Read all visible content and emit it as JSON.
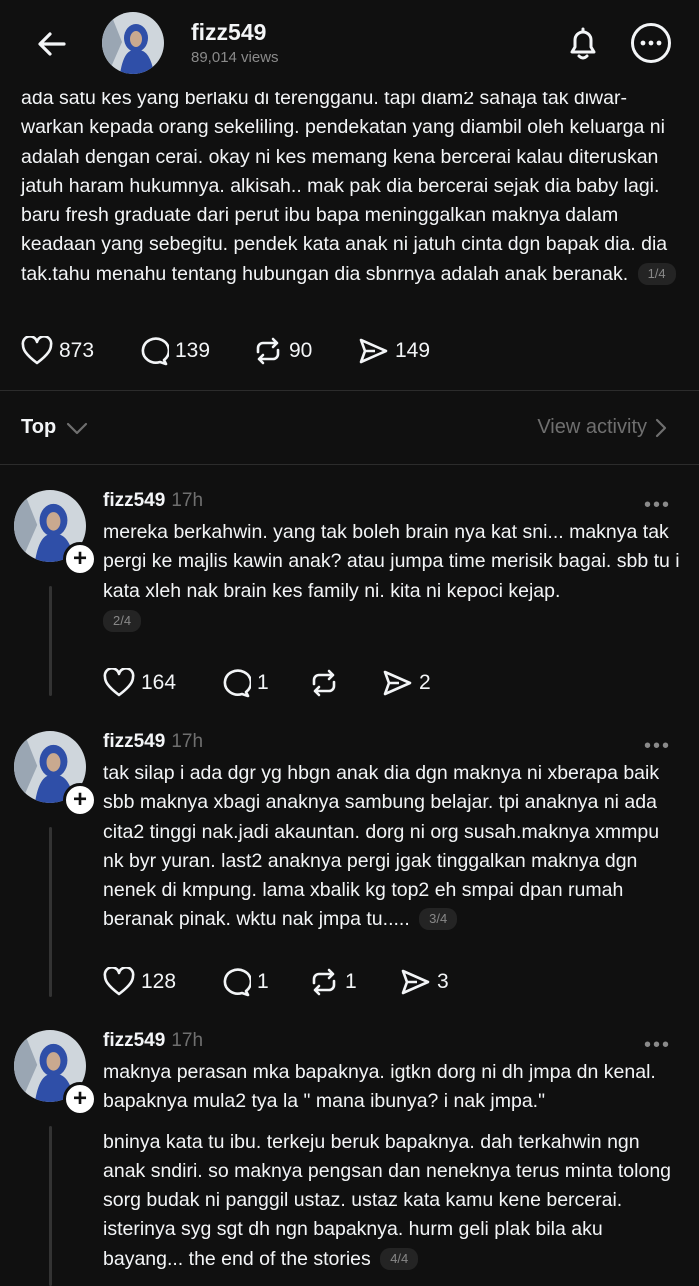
{
  "header": {
    "username": "fizz549",
    "views": "89,014 views",
    "icons": [
      "back-arrow-icon",
      "bell-icon",
      "more-options-icon"
    ]
  },
  "post": {
    "text": "ada satu kes yang berlaku di terengganu. tapi diam2 sahaja tak diwar-warkan kepada orang sekeliling. pendekatan yang diambil oleh keluarga ni adalah dengan cerai. okay ni kes memang kena bercerai kalau diteruskan jatuh haram hukumnya. alkisah.. mak pak dia bercerai sejak dia baby lagi. baru fresh graduate dari perut ibu bapa meninggalkan maknya dalam keadaan yang sebegitu. pendek kata anak ni jatuh cinta dgn bapak dia. dia tak.tahu menahu tentang hubungan dia sbnrnya adalah anak beranak.",
    "page": "1/4",
    "likes": "873",
    "comments": "139",
    "reposts": "90",
    "shares": "149"
  },
  "sort": {
    "label": "Top",
    "activity_label": "View activity"
  },
  "replies": [
    {
      "username": "fizz549",
      "time": "17h",
      "paragraphs": [
        "mereka berkahwin. yang tak boleh brain nya kat sni... maknya tak pergi ke majlis kawin anak? atau jumpa time merisik bagai. sbb tu i kata xleh nak brain kes family ni. kita ni kepoci kejap."
      ],
      "page": "2/4",
      "likes": "164",
      "comments": "1",
      "reposts": "",
      "shares": "2"
    },
    {
      "username": "fizz549",
      "time": "17h",
      "paragraphs": [
        "tak silap i ada dgr yg hbgn anak dia dgn maknya ni xberapa baik sbb maknya xbagi anaknya sambung belajar. tpi anaknya ni ada cita2 tinggi nak.jadi akauntan. dorg ni org susah.maknya xmmpu nk byr yuran. last2 anaknya pergi jgak tinggalkan maknya dgn nenek di kmpung. lama xbalik kg top2 eh smpai dpan rumah beranak pinak. wktu nak jmpa tu....."
      ],
      "page": "3/4",
      "likes": "128",
      "comments": "1",
      "reposts": "1",
      "shares": "3"
    },
    {
      "username": "fizz549",
      "time": "17h",
      "paragraphs": [
        "maknya perasan mka bapaknya. igtkn dorg ni dh jmpa dn kenal. bapaknya mula2 tya la \" mana ibunya? i nak jmpa.\"",
        "bninya kata tu ibu. terkeju beruk bapaknya. dah terkahwin ngn anak sndiri. so maknya pengsan dan neneknya terus minta tolong sorg budak ni panggil ustaz. ustaz kata kamu kene bercerai. isterinya syg sgt dh ngn bapaknya. hurm geli plak bila aku bayang... the end of the stories"
      ],
      "page": "4/4"
    }
  ],
  "colors": {
    "background": "#101010",
    "text": "#f3f5f7",
    "muted": "#6f6f6f",
    "avatar_blue": "#2f4fa8"
  }
}
